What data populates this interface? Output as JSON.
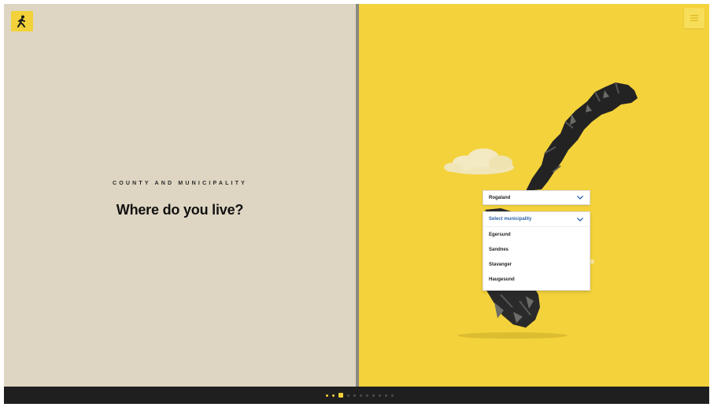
{
  "left": {
    "eyebrow": "COUNTY AND MUNICIPALITY",
    "title": "Where do you live?"
  },
  "county_select": {
    "value": "Rogaland"
  },
  "municipality_select": {
    "placeholder": "Select municipality",
    "options": [
      "Egersund",
      "Sandnes",
      "Stavanger",
      "Haugesund"
    ]
  },
  "progress": {
    "total_steps": 11,
    "current_step": 3
  },
  "colors": {
    "left_background": "#ded6c2",
    "right_background": "#f4d23b",
    "accent": "#f2d13a",
    "bottom_bar": "#1f1f1f",
    "dropdown_placeholder": "#2b62a8"
  },
  "icons": {
    "logo": "person-walking-logo-icon",
    "menu": "menu-icon",
    "chevron": "chevron-down-icon"
  }
}
